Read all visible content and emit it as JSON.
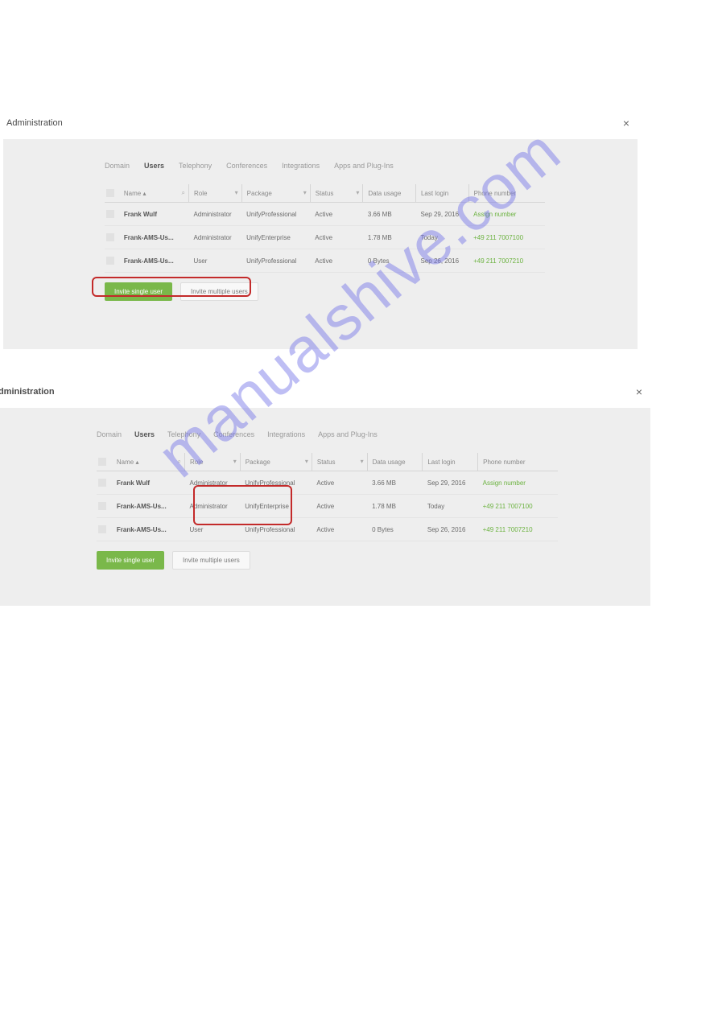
{
  "watermark": "manualshive.com",
  "panel1": {
    "title": "Administration",
    "tabs": [
      "Domain",
      "Users",
      "Telephony",
      "Conferences",
      "Integrations",
      "Apps and Plug-Ins"
    ],
    "active_tab": 1,
    "columns": {
      "name": "Name",
      "role": "Role",
      "package": "Package",
      "status": "Status",
      "data": "Data usage",
      "last": "Last login",
      "phone": "Phone number"
    },
    "rows": [
      {
        "name": "Frank Wulf",
        "role": "Administrator",
        "package": "UnifyProfessional",
        "status": "Active",
        "data": "3.66 MB",
        "last": "Sep 29, 2016",
        "phone": "Assign number",
        "phone_is_action": true
      },
      {
        "name": "Frank-AMS-Us...",
        "role": "Administrator",
        "package": "UnifyEnterprise",
        "status": "Active",
        "data": "1.78 MB",
        "last": "Today",
        "phone": "+49 211 7007100",
        "phone_is_action": false
      },
      {
        "name": "Frank-AMS-Us...",
        "role": "User",
        "package": "UnifyProfessional",
        "status": "Active",
        "data": "0 Bytes",
        "last": "Sep 26, 2016",
        "phone": "+49 211 7007210",
        "phone_is_action": false
      }
    ],
    "buttons": {
      "primary": "Invite single user",
      "secondary": "Invite multiple users"
    }
  },
  "panel2": {
    "title": "Administration",
    "tabs": [
      "Domain",
      "Users",
      "Telephony",
      "Conferences",
      "Integrations",
      "Apps and Plug-Ins"
    ],
    "active_tab": 1,
    "columns": {
      "name": "Name",
      "role": "Role",
      "package": "Package",
      "status": "Status",
      "data": "Data usage",
      "last": "Last login",
      "phone": "Phone number"
    },
    "rows": [
      {
        "name": "Frank Wulf",
        "role": "Administrator",
        "package": "UnifyProfessional",
        "status": "Active",
        "data": "3.66 MB",
        "last": "Sep 29, 2016",
        "phone": "Assign number",
        "phone_is_action": true
      },
      {
        "name": "Frank-AMS-Us...",
        "role": "Administrator",
        "package": "UnifyEnterprise",
        "status": "Active",
        "data": "1.78 MB",
        "last": "Today",
        "phone": "+49 211 7007100",
        "phone_is_action": false
      },
      {
        "name": "Frank-AMS-Us...",
        "role": "User",
        "package": "UnifyProfessional",
        "status": "Active",
        "data": "0 Bytes",
        "last": "Sep 26, 2016",
        "phone": "+49 211 7007210",
        "phone_is_action": false
      }
    ],
    "buttons": {
      "primary": "Invite single user",
      "secondary": "Invite multiple users"
    }
  }
}
